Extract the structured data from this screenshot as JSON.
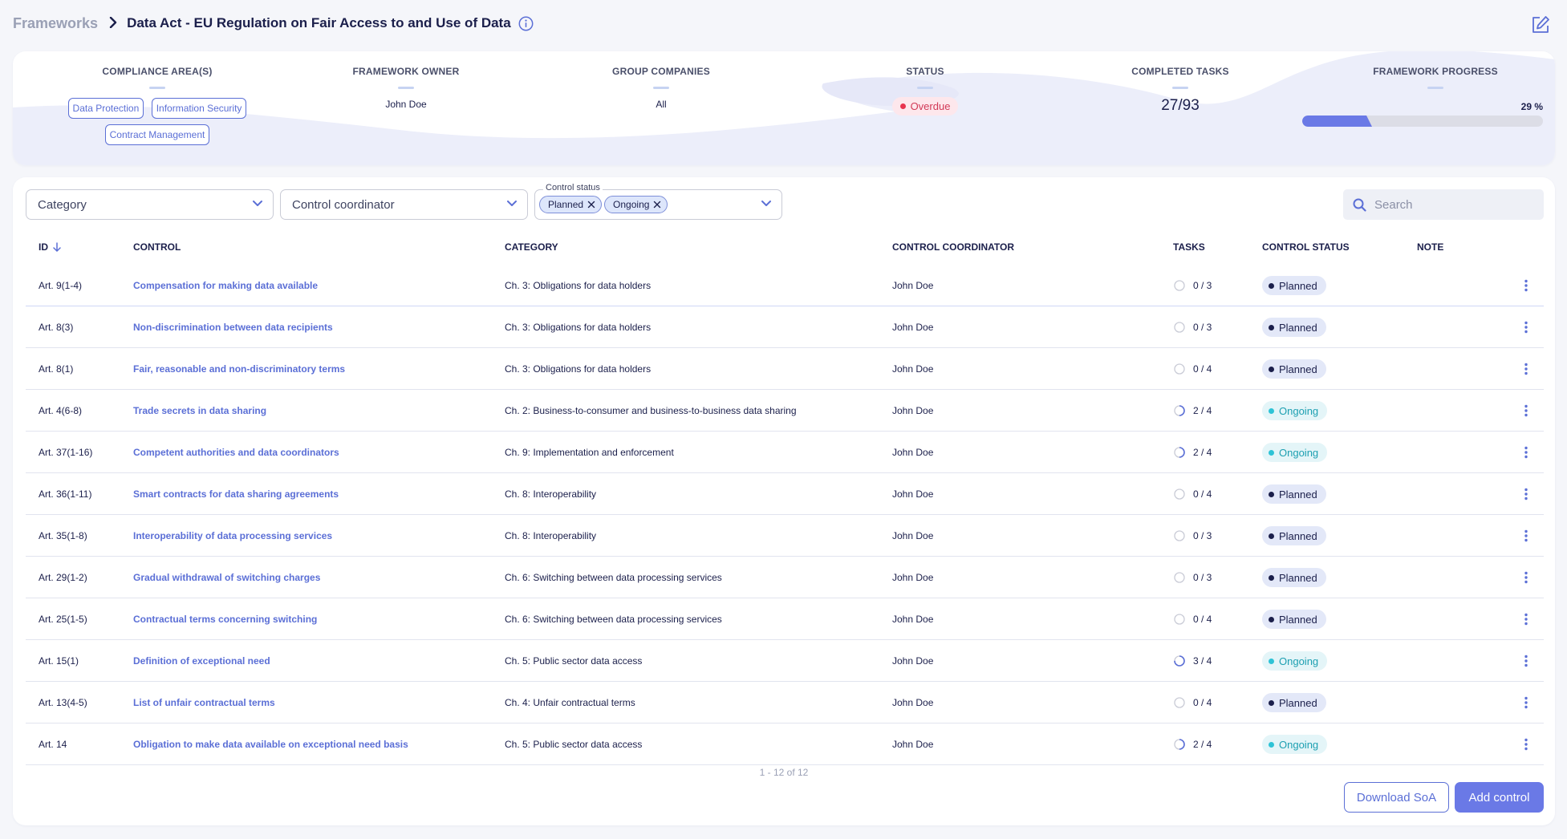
{
  "breadcrumb": {
    "root": "Frameworks",
    "title": "Data Act - EU Regulation on Fair Access to and Use of Data"
  },
  "icons": {
    "chevron_right": "chevron-right-icon",
    "info": "info-icon",
    "edit": "edit-icon",
    "search": "search-icon",
    "sort": "arrow-down-icon",
    "more": "more-vertical-icon",
    "remove": "close-icon"
  },
  "summary": {
    "compliance_label": "COMPLIANCE AREA(S)",
    "compliance_tags": [
      "Data Protection",
      "Information Security",
      "Contract Management"
    ],
    "owner_label": "FRAMEWORK OWNER",
    "owner_value": "John Doe",
    "companies_label": "GROUP COMPANIES",
    "companies_value": "All",
    "status_label": "STATUS",
    "status_value": "Overdue",
    "completed_label": "COMPLETED TASKS",
    "completed_value": "27/93",
    "progress_label": "FRAMEWORK PROGRESS",
    "progress_text": "29 %",
    "progress_value": 0.29
  },
  "filters": {
    "category": "Category",
    "coordinator": "Control coordinator",
    "status_label": "Control status",
    "status_chips": [
      "Planned",
      "Ongoing"
    ],
    "search_placeholder": "Search"
  },
  "table": {
    "headers": {
      "id": "ID",
      "control": "CONTROL",
      "category": "CATEGORY",
      "coordinator": "CONTROL COORDINATOR",
      "tasks": "TASKS",
      "status": "CONTROL STATUS",
      "note": "NOTE"
    },
    "rows": [
      {
        "id": "Art. 9(1-4)",
        "control": "Compensation for making data available",
        "category": "Ch. 3: Obligations for data holders",
        "coordinator": "John Doe",
        "tasks": "0 / 3",
        "done": 0,
        "total": 3,
        "status": "Planned"
      },
      {
        "id": "Art. 8(3)",
        "control": "Non-discrimination between data recipients",
        "category": "Ch. 3: Obligations for data holders",
        "coordinator": "John Doe",
        "tasks": "0 / 3",
        "done": 0,
        "total": 3,
        "status": "Planned"
      },
      {
        "id": "Art. 8(1)",
        "control": "Fair, reasonable and non-discriminatory terms",
        "category": "Ch. 3: Obligations for data holders",
        "coordinator": "John Doe",
        "tasks": "0 / 4",
        "done": 0,
        "total": 4,
        "status": "Planned"
      },
      {
        "id": "Art. 4(6-8)",
        "control": "Trade secrets in data sharing",
        "category": "Ch. 2: Business-to-consumer and business-to-business data sharing",
        "coordinator": "John Doe",
        "tasks": "2 / 4",
        "done": 2,
        "total": 4,
        "status": "Ongoing"
      },
      {
        "id": "Art. 37(1-16)",
        "control": "Competent authorities and data coordinators",
        "category": "Ch. 9: Implementation and enforcement",
        "coordinator": "John Doe",
        "tasks": "2 / 4",
        "done": 2,
        "total": 4,
        "status": "Ongoing"
      },
      {
        "id": "Art. 36(1-11)",
        "control": "Smart contracts for data sharing agreements",
        "category": "Ch. 8: Interoperability",
        "coordinator": "John Doe",
        "tasks": "0 / 4",
        "done": 0,
        "total": 4,
        "status": "Planned"
      },
      {
        "id": "Art. 35(1-8)",
        "control": "Interoperability of data processing services",
        "category": "Ch. 8: Interoperability",
        "coordinator": "John Doe",
        "tasks": "0 / 3",
        "done": 0,
        "total": 3,
        "status": "Planned"
      },
      {
        "id": "Art. 29(1-2)",
        "control": "Gradual withdrawal of switching charges",
        "category": "Ch. 6: Switching between data processing services",
        "coordinator": "John Doe",
        "tasks": "0 / 3",
        "done": 0,
        "total": 3,
        "status": "Planned"
      },
      {
        "id": "Art. 25(1-5)",
        "control": "Contractual terms concerning switching",
        "category": "Ch. 6: Switching between data processing services",
        "coordinator": "John Doe",
        "tasks": "0 / 4",
        "done": 0,
        "total": 4,
        "status": "Planned"
      },
      {
        "id": "Art. 15(1)",
        "control": "Definition of exceptional need",
        "category": "Ch. 5: Public sector data access",
        "coordinator": "John Doe",
        "tasks": "3 / 4",
        "done": 3,
        "total": 4,
        "status": "Ongoing"
      },
      {
        "id": "Art. 13(4-5)",
        "control": "List of unfair contractual terms",
        "category": "Ch. 4: Unfair contractual terms",
        "coordinator": "John Doe",
        "tasks": "0 / 4",
        "done": 0,
        "total": 4,
        "status": "Planned"
      },
      {
        "id": "Art. 14",
        "control": "Obligation to make data available on exceptional need basis",
        "category": "Ch. 5: Public sector data access",
        "coordinator": "John Doe",
        "tasks": "2 / 4",
        "done": 2,
        "total": 4,
        "status": "Ongoing"
      }
    ]
  },
  "pagination": "1 - 12 of 12",
  "actions": {
    "download": "Download SoA",
    "add": "Add control"
  },
  "colors": {
    "accent": "#5b6fd6",
    "primary_button": "#6a79e6",
    "overdue": "#e8334e",
    "ongoing": "#2ec3d6",
    "planned": "#1b1f4b"
  }
}
